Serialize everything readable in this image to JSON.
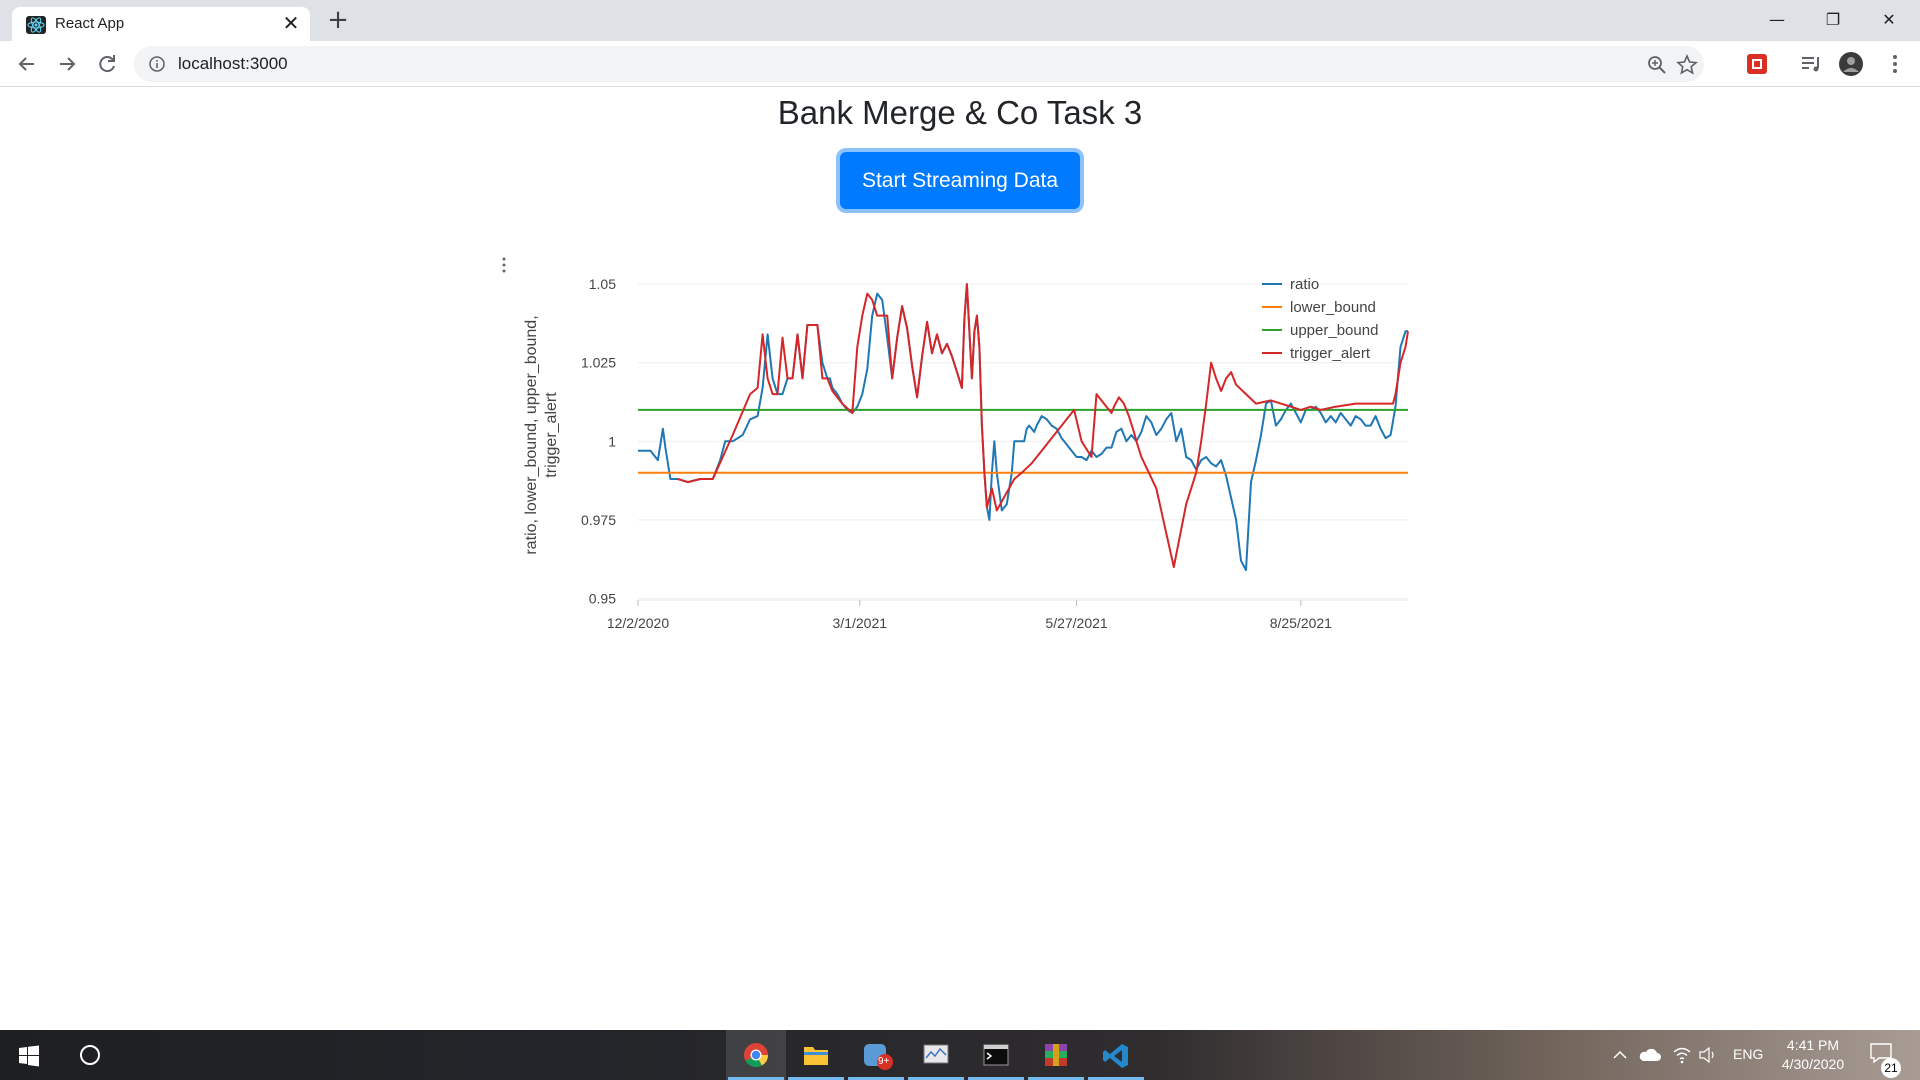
{
  "browser": {
    "tab_title": "React App",
    "tab_close": "✕",
    "new_tab": "+",
    "url": "localhost:3000",
    "window_controls": {
      "minimize": "—",
      "restore": "❐",
      "close": "✕"
    }
  },
  "page": {
    "title": "Bank Merge & Co Task 3",
    "button_label": "Start Streaming Data"
  },
  "chart_data": {
    "type": "line",
    "title": "",
    "xlabel": "",
    "ylabel": "ratio, lower_bound, upper_bound, trigger_alert",
    "ylabel_lines": [
      "ratio, lower_bound, upper_bound,",
      "trigger_alert"
    ],
    "x_ticks": [
      "12/2/2020",
      "3/1/2021",
      "5/27/2021",
      "8/25/2021"
    ],
    "x_tick_days": [
      0,
      89,
      176,
      266
    ],
    "x_range_days": [
      0,
      309
    ],
    "y_ticks": [
      0.95,
      0.975,
      1,
      1.025,
      1.05
    ],
    "y_tick_labels": [
      "0.95",
      "0.975",
      "1",
      "1.025",
      "1.05"
    ],
    "ylim": [
      0.9495,
      1.0545
    ],
    "grid": true,
    "legend_position": "top-right",
    "series": [
      {
        "name": "ratio",
        "color": "#1f77b4",
        "x": [
          0,
          5,
          8,
          10,
          11,
          13,
          16,
          20,
          25,
          30,
          33,
          35,
          38,
          42,
          45,
          48,
          50,
          52,
          54,
          56,
          58,
          60,
          62,
          64,
          66,
          68,
          70,
          72,
          74,
          76,
          77,
          78,
          80,
          82,
          84,
          86,
          88,
          90,
          92,
          94,
          96,
          98,
          100,
          102,
          104,
          106,
          108,
          110,
          112,
          114,
          116,
          118,
          120,
          122,
          124,
          126,
          128,
          130,
          131,
          132,
          133,
          134,
          135,
          136,
          137,
          138,
          139,
          140,
          141,
          142,
          143,
          144,
          146,
          148,
          150,
          151,
          152,
          153,
          154,
          155,
          156,
          157,
          158,
          159,
          160,
          162,
          164,
          166,
          168,
          170,
          172,
          174,
          176,
          178,
          180,
          182,
          184,
          186,
          188,
          190,
          192,
          194,
          196,
          198,
          200,
          202,
          204,
          206,
          208,
          210,
          212,
          214,
          216,
          218,
          220,
          222,
          224,
          226,
          228,
          230,
          232,
          234,
          236,
          238,
          240,
          242,
          244,
          246,
          248,
          250,
          252,
          254,
          256,
          258,
          260,
          262,
          264,
          266,
          268,
          270,
          272,
          274,
          276,
          278,
          280,
          282,
          284,
          286,
          288,
          290,
          292,
          294,
          296,
          298,
          300,
          302,
          304,
          306,
          308,
          309
        ],
        "y": [
          0.997,
          0.997,
          0.994,
          1.004,
          0.998,
          0.988,
          0.988,
          0.987,
          0.988,
          0.988,
          0.994,
          1.0,
          1.0,
          1.002,
          1.007,
          1.008,
          1.017,
          1.034,
          1.02,
          1.015,
          1.015,
          1.02,
          1.02,
          1.034,
          1.02,
          1.037,
          1.037,
          1.037,
          1.025,
          1.02,
          1.02,
          1.017,
          1.015,
          1.012,
          1.01,
          1.009,
          1.011,
          1.015,
          1.023,
          1.04,
          1.047,
          1.045,
          1.033,
          1.02,
          1.033,
          1.043,
          1.036,
          1.024,
          1.014,
          1.027,
          1.038,
          1.028,
          1.034,
          1.028,
          1.031,
          1.027,
          1.022,
          1.017,
          1.039,
          1.05,
          1.035,
          1.02,
          1.035,
          1.04,
          1.03,
          1.005,
          0.99,
          0.979,
          0.975,
          0.99,
          1.0,
          0.99,
          0.978,
          0.98,
          0.99,
          1.0,
          1.0,
          1.0,
          1.0,
          1.0,
          1.004,
          1.005,
          1.004,
          1.003,
          1.005,
          1.008,
          1.007,
          1.005,
          1.004,
          1.001,
          0.999,
          0.997,
          0.995,
          0.995,
          0.994,
          0.997,
          0.995,
          0.996,
          0.998,
          0.998,
          1.003,
          1.004,
          1.0,
          1.002,
          1.0,
          1.003,
          1.008,
          1.006,
          1.002,
          1.004,
          1.007,
          1.009,
          1.0,
          1.004,
          0.995,
          0.994,
          0.991,
          0.994,
          0.995,
          0.993,
          0.992,
          0.994,
          0.989,
          0.982,
          0.975,
          0.962,
          0.959,
          0.987,
          0.994,
          1.002,
          1.012,
          1.013,
          1.005,
          1.007,
          1.01,
          1.012,
          1.009,
          1.006,
          1.01,
          1.01,
          1.011,
          1.009,
          1.006,
          1.008,
          1.006,
          1.009,
          1.007,
          1.005,
          1.008,
          1.007,
          1.005,
          1.005,
          1.008,
          1.004,
          1.001,
          1.002,
          1.011,
          1.03,
          1.035,
          1.035
        ],
        "note": "data series rendered beneath trigger_alert"
      },
      {
        "name": "lower_bound",
        "color": "#ff7f0e",
        "x": [
          0,
          309
        ],
        "y": [
          0.99,
          0.99
        ]
      },
      {
        "name": "upper_bound",
        "color": "#2ca02c",
        "x": [
          0,
          309
        ],
        "y": [
          1.01,
          1.01
        ]
      },
      {
        "name": "trigger_alert",
        "color": "#d62728",
        "x": [
          16,
          20,
          25,
          30,
          38,
          45,
          48,
          50,
          52,
          54,
          56,
          58,
          60,
          62,
          64,
          66,
          68,
          70,
          72,
          74,
          76,
          78,
          82,
          86,
          88,
          90,
          92,
          94,
          96,
          98,
          100,
          102,
          104,
          106,
          108,
          110,
          112,
          114,
          116,
          118,
          120,
          122,
          124,
          126,
          128,
          130,
          131,
          132,
          133,
          134,
          135,
          136,
          137,
          138,
          139,
          140,
          142,
          144,
          151,
          154,
          158,
          162,
          165,
          170,
          175,
          178,
          182,
          184,
          188,
          190,
          191,
          193,
          195,
          197,
          199,
          200,
          202,
          208,
          215,
          220,
          224,
          226,
          228,
          230,
          232,
          234,
          236,
          238,
          240,
          244,
          248,
          254,
          258,
          262,
          266,
          270,
          274,
          280,
          288,
          296,
          303,
          304,
          306,
          308,
          309
        ],
        "y": [
          0.988,
          0.987,
          0.988,
          0.988,
          1.002,
          1.015,
          1.017,
          1.034,
          1.02,
          1.015,
          1.015,
          1.033,
          1.02,
          1.02,
          1.034,
          1.02,
          1.037,
          1.037,
          1.037,
          1.02,
          1.02,
          1.016,
          1.012,
          1.009,
          1.03,
          1.04,
          1.047,
          1.045,
          1.04,
          1.04,
          1.04,
          1.02,
          1.033,
          1.043,
          1.036,
          1.024,
          1.014,
          1.027,
          1.038,
          1.028,
          1.034,
          1.028,
          1.031,
          1.027,
          1.022,
          1.017,
          1.039,
          1.05,
          1.035,
          1.02,
          1.035,
          1.04,
          1.03,
          1.005,
          0.99,
          0.979,
          0.985,
          0.978,
          0.988,
          0.99,
          0.993,
          0.997,
          1.0,
          1.005,
          1.01,
          1.0,
          0.995,
          1.015,
          1.011,
          1.009,
          1.011,
          1.014,
          1.012,
          1.008,
          1.003,
          1.0,
          0.995,
          0.985,
          0.96,
          0.98,
          0.99,
          1.0,
          1.012,
          1.025,
          1.02,
          1.016,
          1.02,
          1.022,
          1.018,
          1.015,
          1.012,
          1.013,
          1.012,
          1.011,
          1.01,
          1.011,
          1.01,
          1.011,
          1.012,
          1.012,
          1.012,
          1.015,
          1.025,
          1.03,
          1.035
        ]
      }
    ]
  },
  "taskbar": {
    "language": "ENG",
    "time": "4:41 PM",
    "date": "4/30/2020",
    "notification_count": "21",
    "badge_9plus": "9+"
  }
}
